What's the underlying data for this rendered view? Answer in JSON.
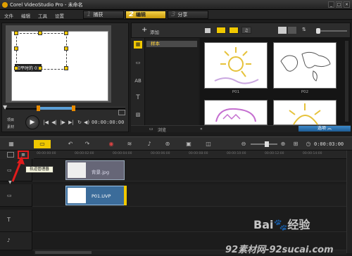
{
  "window": {
    "title": "Corel VideoStudio Pro - 未命名"
  },
  "menu": [
    "文件",
    "编辑",
    "工具",
    "设置"
  ],
  "steps": [
    {
      "num": "1",
      "label": "捕获",
      "active": false
    },
    {
      "num": "2",
      "label": "编辑",
      "active": true
    },
    {
      "num": "3",
      "label": "分享",
      "active": false
    }
  ],
  "preview": {
    "overlay_text": "和平时的 01",
    "timecode": "00:00:00:00"
  },
  "library": {
    "add_label": "添加",
    "folder": "样本",
    "browse_label": "浏览",
    "options_label": "选项",
    "thumbs": [
      {
        "caption": "P01"
      },
      {
        "caption": "P02"
      },
      {
        "caption": ""
      },
      {
        "caption": ""
      }
    ]
  },
  "timeline": {
    "timecode": "0:00:03:00",
    "ruler": [
      "00:00:00:00",
      "00:00:02:00",
      "00:00:04:00",
      "00:00:06:00",
      "00:00:08:00",
      "00:00:10:00",
      "00:00:12:00",
      "00:00:14:00"
    ],
    "track_manager_tooltip": "轨道管理器",
    "clips": [
      {
        "label": "背景.jpg"
      },
      {
        "label": "P01.UVP"
      }
    ]
  },
  "watermarks": {
    "baidu": "Bai🐾经验",
    "site": "92素材网-92sucai.com"
  },
  "colors": {
    "accent": "#f0c800",
    "highlight": "#e01c1c",
    "selection": "#3b6c9a"
  }
}
